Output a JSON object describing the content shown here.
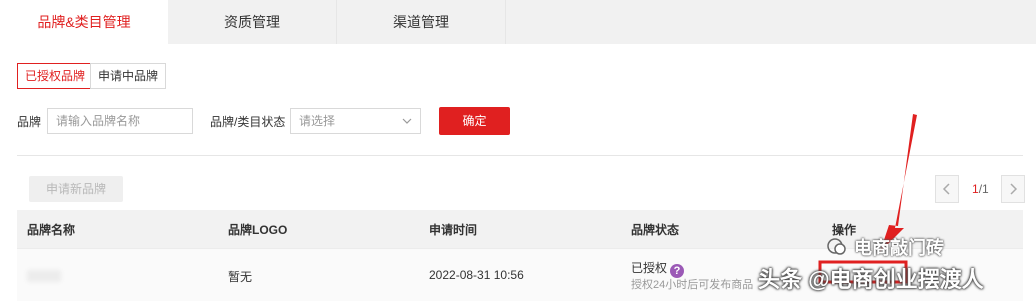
{
  "tabs": [
    {
      "label": "品牌&类目管理"
    },
    {
      "label": "资质管理"
    },
    {
      "label": "渠道管理"
    }
  ],
  "subtabs": [
    {
      "label": "已授权品牌"
    },
    {
      "label": "申请中品牌"
    }
  ],
  "filters": {
    "brand_label": "品牌",
    "brand_placeholder": "请输入品牌名称",
    "status_label": "品牌/类目状态",
    "status_placeholder": "请选择",
    "confirm_label": "确定"
  },
  "apply_button_label": "申请新品牌",
  "pagination": {
    "current": "1",
    "total": "/1"
  },
  "table": {
    "columns": [
      "品牌名称",
      "品牌LOGO",
      "申请时间",
      "品牌状态",
      "操作"
    ],
    "rows": [
      {
        "logo": "暂无",
        "time": "2022-08-31 10:56",
        "status": "已授权",
        "status_note": "授权24小时后可发布商品"
      }
    ]
  },
  "watermark": {
    "line1": "电商敲门砖",
    "line2": "头条 @电商创业摆渡人"
  },
  "colors": {
    "accent": "#e02020",
    "help_icon": "#9b59b6"
  }
}
